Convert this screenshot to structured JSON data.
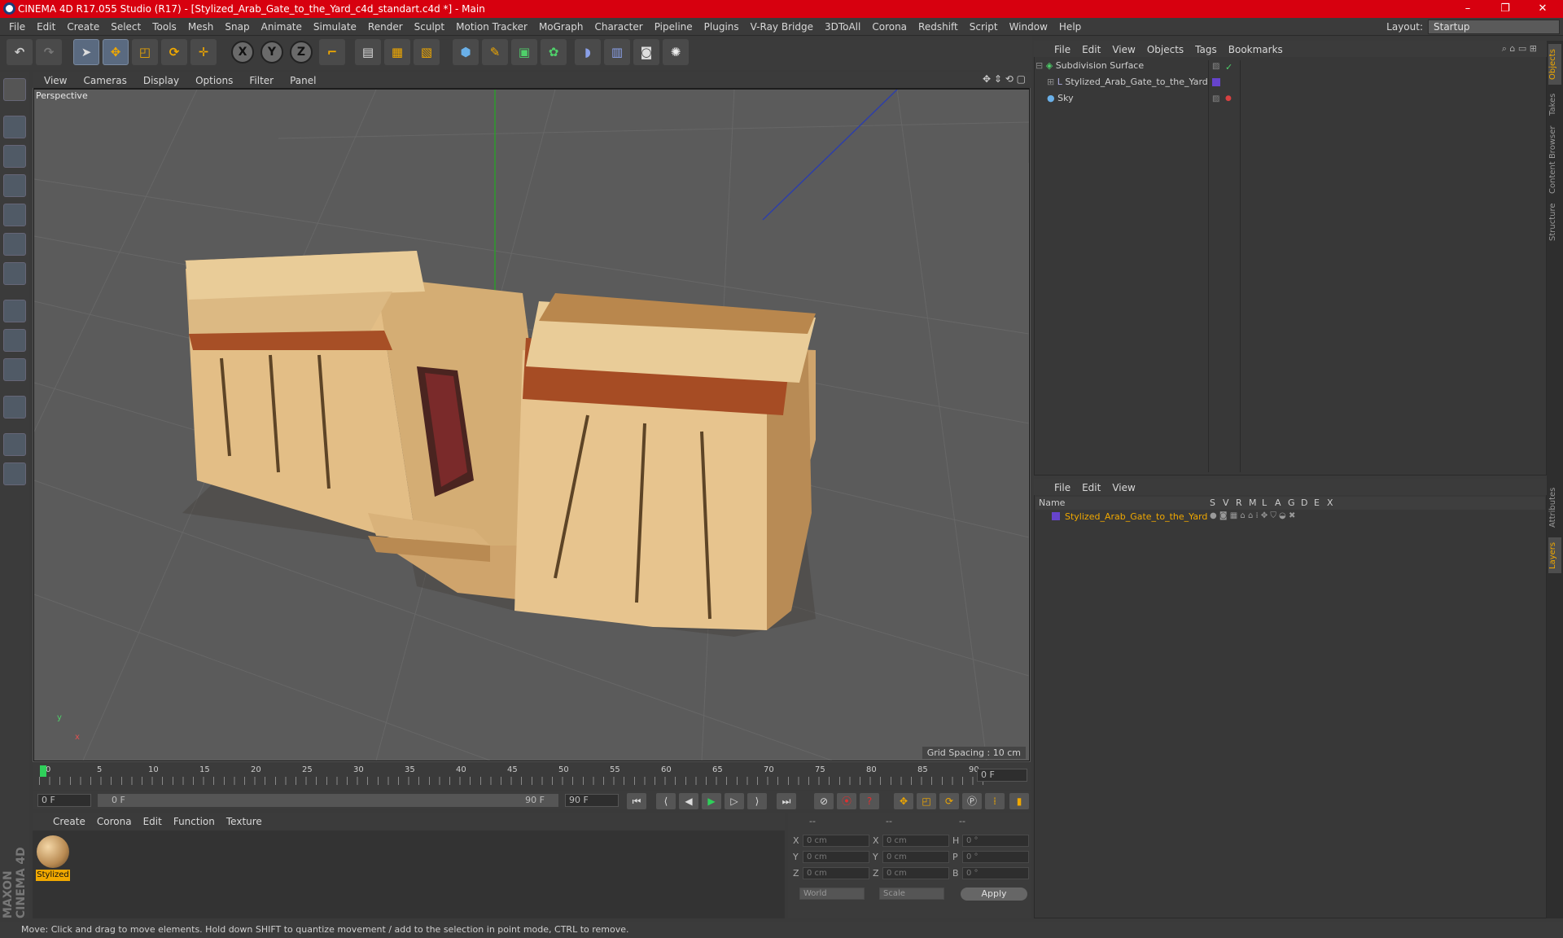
{
  "titlebar": {
    "title": "CINEMA 4D R17.055 Studio (R17) - [Stylized_Arab_Gate_to_the_Yard_c4d_standart.c4d *] - Main",
    "minimize": "–",
    "restore": "❐",
    "close": "✕"
  },
  "menubar": {
    "items": [
      "File",
      "Edit",
      "Create",
      "Select",
      "Tools",
      "Mesh",
      "Snap",
      "Animate",
      "Simulate",
      "Render",
      "Sculpt",
      "Motion Tracker",
      "MoGraph",
      "Character",
      "Pipeline",
      "Plugins",
      "V-Ray Bridge",
      "3DToAll",
      "Corona",
      "Redshift",
      "Script",
      "Window",
      "Help"
    ]
  },
  "layout": {
    "label": "Layout:",
    "value": "Startup"
  },
  "toolbar": {
    "axis_x": "X",
    "axis_y": "Y",
    "axis_z": "Z"
  },
  "viewport": {
    "menu": [
      "View",
      "Cameras",
      "Display",
      "Options",
      "Filter",
      "Panel"
    ],
    "label": "Perspective",
    "grid_spacing": "Grid Spacing : 10 cm",
    "axis_y": "y",
    "axis_x": "x"
  },
  "timeline": {
    "ticks": [
      "0",
      "5",
      "10",
      "15",
      "20",
      "25",
      "30",
      "35",
      "40",
      "45",
      "50",
      "55",
      "60",
      "65",
      "70",
      "75",
      "80",
      "85",
      "90"
    ],
    "current_frame_field": "0 F",
    "start_field": "0 F",
    "range_start": "0 F",
    "range_end": "90 F",
    "end_field": "90 F"
  },
  "material_manager": {
    "menu": [
      "Create",
      "Corona",
      "Edit",
      "Function",
      "Texture"
    ],
    "material_name": "Stylized"
  },
  "coordinates": {
    "header": [
      "--",
      "--",
      "--"
    ],
    "rows": [
      {
        "a": "X",
        "av": "0 cm",
        "b": "X",
        "bv": "0 cm",
        "c": "H",
        "cv": "0 °"
      },
      {
        "a": "Y",
        "av": "0 cm",
        "b": "Y",
        "bv": "0 cm",
        "c": "P",
        "cv": "0 °"
      },
      {
        "a": "Z",
        "av": "0 cm",
        "b": "Z",
        "bv": "0 cm",
        "c": "B",
        "cv": "0 °"
      }
    ],
    "mode": "World",
    "scale": "Scale",
    "apply": "Apply"
  },
  "object_manager": {
    "menu": [
      "File",
      "Edit",
      "View",
      "Objects",
      "Tags",
      "Bookmarks"
    ],
    "objects": [
      "Subdivision Surface",
      "Stylized_Arab_Gate_to_the_Yard",
      "Sky"
    ]
  },
  "layer_manager": {
    "menu": [
      "File",
      "Edit",
      "View"
    ],
    "columns": [
      "Name",
      "S",
      "V",
      "R",
      "M",
      "L",
      "A",
      "G",
      "D",
      "E",
      "X"
    ],
    "layer": "Stylized_Arab_Gate_to_the_Yard"
  },
  "right_tabs": [
    "Objects",
    "Takes",
    "Content Browser",
    "Structure",
    "Attributes",
    "Layers"
  ],
  "status": "Move: Click and drag to move elements. Hold down SHIFT to quantize movement / add to the selection in point mode, CTRL to remove.",
  "branding": "MAXON CINEMA 4D",
  "colors": {
    "titlebar": "#d7000f",
    "accent": "#f0a800",
    "viewport_bg": "#5b5b5b"
  }
}
